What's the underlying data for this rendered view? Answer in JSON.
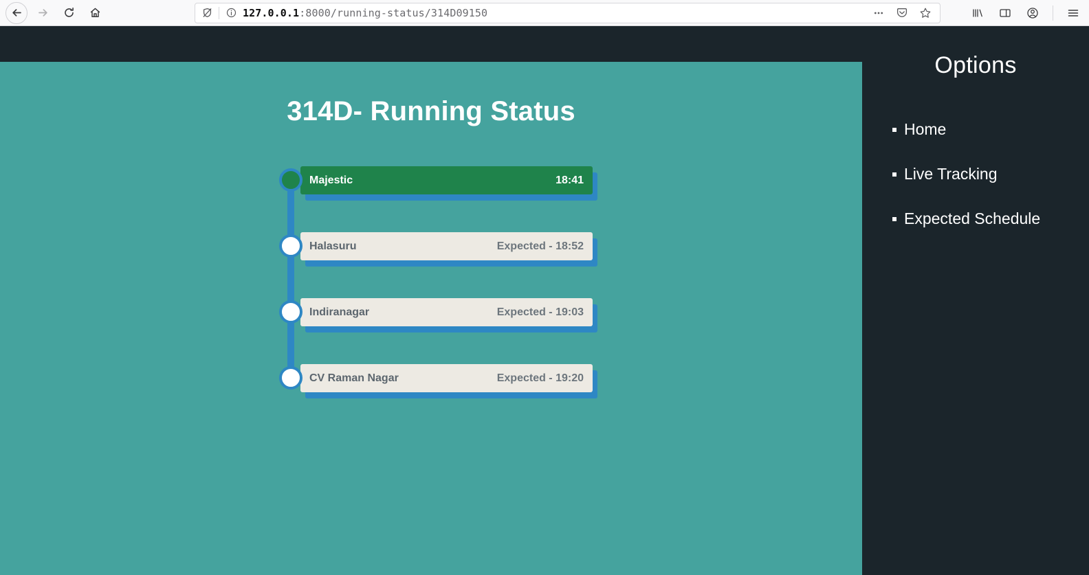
{
  "browser": {
    "back_icon": "back-arrow-icon",
    "forward_icon": "forward-arrow-icon",
    "reload_icon": "reload-icon",
    "home_icon": "home-icon",
    "shield_icon": "tracking-protection-off-icon",
    "info_icon": "site-info-icon",
    "url_host": "127.0.0.1",
    "url_rest": ":8000/running-status/314D09150",
    "ellipsis_icon": "page-actions-icon",
    "pocket_icon": "pocket-icon",
    "star_icon": "bookmark-star-icon",
    "library_icon": "library-icon",
    "sidebar_icon": "sidebars-icon",
    "account_icon": "account-icon",
    "menu_icon": "hamburger-menu-icon"
  },
  "main": {
    "title_route": "314D",
    "title_dash": "-",
    "title_rest": "Running Status",
    "stops": [
      {
        "name": "Majestic",
        "time": "18:41",
        "state": "current"
      },
      {
        "name": "Halasuru",
        "time": "Expected - 18:52",
        "state": "upcoming"
      },
      {
        "name": "Indiranagar",
        "time": "Expected - 19:03",
        "state": "upcoming"
      },
      {
        "name": "CV Raman Nagar",
        "time": "Expected - 19:20",
        "state": "upcoming"
      }
    ]
  },
  "sidebar": {
    "title": "Options",
    "items": [
      {
        "label": "Home"
      },
      {
        "label": "Live Tracking"
      },
      {
        "label": "Expected Schedule"
      }
    ]
  },
  "colors": {
    "teal_background": "#45a39e",
    "dark_background": "#1b252b",
    "rail_blue": "#2e87c4",
    "current_green": "#1f834b",
    "card_beige": "#edeae3"
  }
}
